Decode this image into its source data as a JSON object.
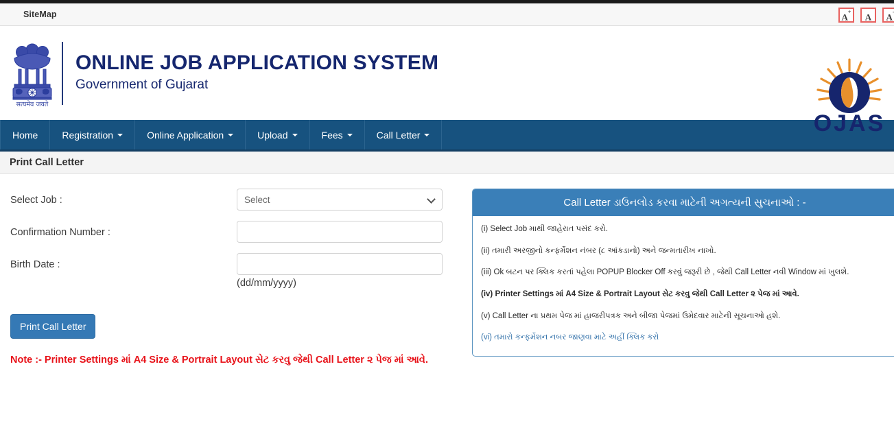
{
  "topbar": {
    "sitemap_label": "SiteMap",
    "font_buttons": [
      {
        "name": "increase-font-size",
        "label": "A",
        "sup": "+"
      },
      {
        "name": "normal-font-size",
        "label": "A",
        "sup": ""
      },
      {
        "name": "decrease-font-size",
        "label": "A",
        "sup": "-"
      }
    ]
  },
  "masthead": {
    "emblem_motto": "सत्यमेव जयते",
    "title": "ONLINE JOB APPLICATION SYSTEM",
    "subtitle": "Government of Gujarat",
    "logo_text": "OJAS"
  },
  "nav": {
    "items": [
      {
        "label": "Home",
        "caret": false
      },
      {
        "label": "Registration",
        "caret": true
      },
      {
        "label": "Online Application",
        "caret": true
      },
      {
        "label": "Upload",
        "caret": true
      },
      {
        "label": "Fees",
        "caret": true
      },
      {
        "label": "Call Letter",
        "caret": true
      }
    ]
  },
  "page": {
    "title": "Print Call Letter"
  },
  "form": {
    "select_job_label": "Select Job :",
    "select_job_value": "Select",
    "confirmation_label": "Confirmation Number :",
    "confirmation_value": "",
    "confirmation_placeholder": "",
    "birth_date_label": "Birth Date :",
    "birth_date_value": "",
    "birth_date_placeholder": "",
    "birth_date_hint": "(dd/mm/yyyy)",
    "submit_label": "Print Call Letter",
    "note": "Note :- Printer Settings માં A4 Size & Portrait Layout સેટ કરવુ જેથી Call Letter ૨ પેજ માં આવે."
  },
  "panel": {
    "heading": "Call Letter ડાઉનલોડ કરવા માટેની અગત્યની સુચનાઓ : -",
    "instructions": [
      {
        "text": "(i) Select Job માથી જાહેરાત પસંદ કરો.",
        "bold": false,
        "link": false
      },
      {
        "text": "(ii) તમારી અરજીનો કન્ફર્મેશન નંબર (૮ આંકડાનો) અને જન્મતારીખ નાખો.",
        "bold": false,
        "link": false
      },
      {
        "text": "(iii) Ok બટન પર ક્લિક કરતાં પહેલા POPUP Blocker Off કરવું જરૂરી છે , જેથી Call Letter નવી Window માં ખુલશે.",
        "bold": false,
        "link": false
      },
      {
        "text": "(iv) Printer Settings માં A4 Size & Portrait Layout સેટ કરવુ જેથી Call Letter ૨ પેજ માં આવે.",
        "bold": true,
        "link": false
      },
      {
        "text": "(v) Call Letter ના પ્રથમ પેજ માં હાજરીપત્રક અને બીજા પેજમાં ઉમેદવાર માટેની સૂચનાઓ હશે.",
        "bold": false,
        "link": false
      },
      {
        "text": "(vi) તમારો કન્ફર્મેશન નબર જાણવા માટે અહીં ક્લિક કરો",
        "bold": false,
        "link": true
      }
    ]
  },
  "colors": {
    "nav_blue": "#17527f",
    "title_blue": "#15266e",
    "panel_blue": "#3a7fb8",
    "button_blue": "#3579b5",
    "note_red": "#e8131a",
    "fs_border_red": "#e8615f"
  }
}
